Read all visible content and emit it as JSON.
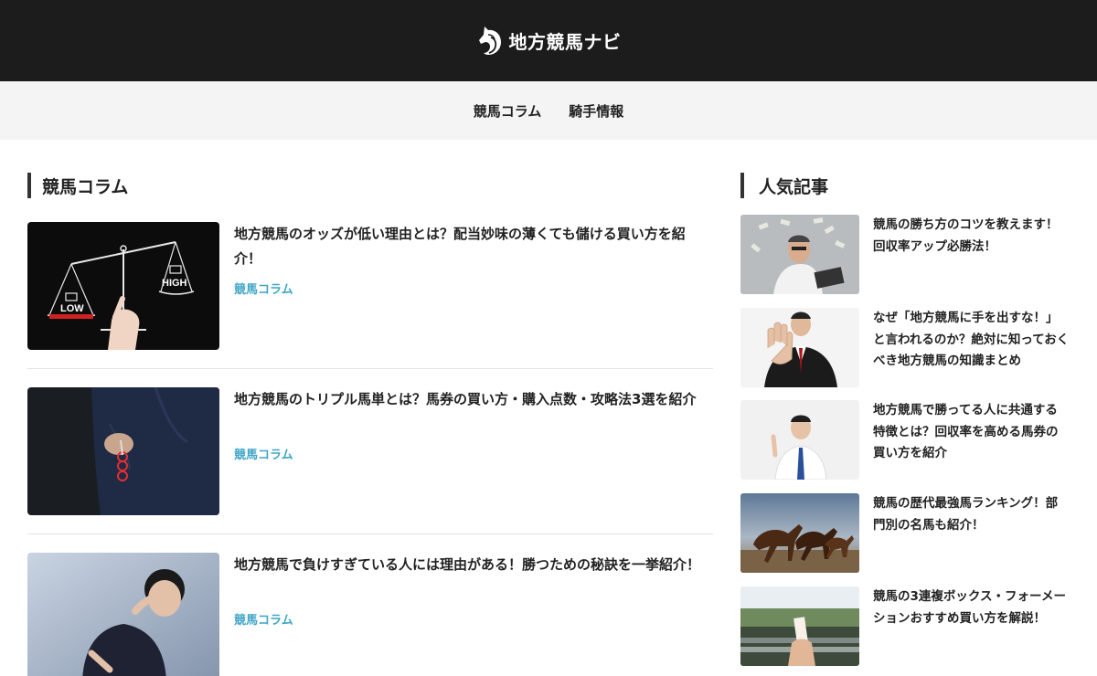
{
  "header": {
    "logo_text": "地方競馬ナビ",
    "logo_icon": "horse-head-icon"
  },
  "nav": {
    "items": [
      "競馬コラム",
      "騎手情報"
    ]
  },
  "main": {
    "section_title": "競馬コラム",
    "posts": [
      {
        "title": "地方競馬のオッズが低い理由とは？配当妙味の薄くても儲ける買い方を紹介！",
        "category": "競馬コラム",
        "thumb": {
          "low_label": "LOW",
          "high_label": "HIGH"
        }
      },
      {
        "title": "地方競馬のトリプル馬単とは？馬券の買い方・購入点数・攻略法3選を紹介",
        "category": "競馬コラム"
      },
      {
        "title": "地方競馬で負けすぎている人には理由がある！勝つための秘訣を一挙紹介！",
        "category": "競馬コラム"
      }
    ]
  },
  "sidebar": {
    "title": "人気記事",
    "items": [
      {
        "text": "競馬の勝ち方のコツを教えます！回収率アップ必勝法！"
      },
      {
        "text": "なぜ「地方競馬に手を出すな！」と言われるのか？絶対に知っておくべき地方競馬の知識まとめ"
      },
      {
        "text": "地方競馬で勝ってる人に共通する特徴とは？回収率を高める馬券の買い方を紹介"
      },
      {
        "text": "競馬の歴代最強馬ランキング！部門別の名馬も紹介！"
      },
      {
        "text": "競馬の3連複ボックス・フォーメーションおすすめ買い方を解説！"
      }
    ]
  },
  "colors": {
    "header_bg": "#1c1c1c",
    "nav_bg": "#f4f4f4",
    "category_link": "#3ea5c6"
  }
}
